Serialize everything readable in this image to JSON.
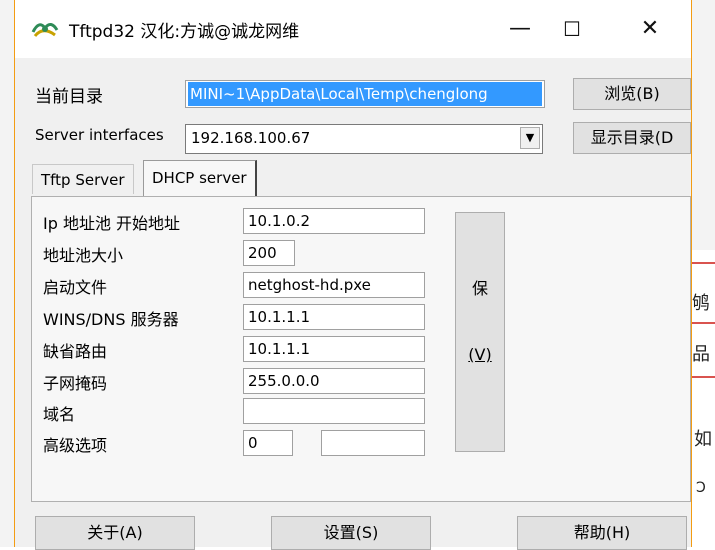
{
  "window": {
    "title": "Tftpd32 汉化:方诚@诚龙网维",
    "minimize": "—",
    "maximize": "☐",
    "close": "✕"
  },
  "top": {
    "current_dir_label": "当前目录",
    "current_dir_value": "MINI~1\\AppData\\Local\\Temp\\chenglong",
    "browse_label": "浏览(B)",
    "server_interfaces_label": "Server interfaces",
    "server_interface_value": "192.168.100.67",
    "show_dir_label": "显示目录(D"
  },
  "tabs": [
    {
      "label": "Tftp Server"
    },
    {
      "label": "DHCP server"
    }
  ],
  "dhcp": {
    "fields": [
      {
        "label": "Ip 地址池 开始地址",
        "value": "10.1.0.2"
      },
      {
        "label": "地址池大小",
        "value": "200"
      },
      {
        "label": "启动文件",
        "value": "netghost-hd.pxe"
      },
      {
        "label": "WINS/DNS 服务器",
        "value": "10.1.1.1"
      },
      {
        "label": "缺省路由",
        "value": "10.1.1.1"
      },
      {
        "label": "子网掩码",
        "value": "255.0.0.0"
      },
      {
        "label": "域名",
        "value": ""
      },
      {
        "label": "高级选项",
        "value": "0",
        "value2": ""
      }
    ],
    "save_label_top": "保",
    "save_label_bottom": "(V)"
  },
  "bottom": {
    "about_label": "关于(A)",
    "settings_label": "设置(S)",
    "help_label": "帮助(H)"
  },
  "background": {
    "chars": [
      "鸲",
      "品",
      "如",
      "Ɔ"
    ]
  },
  "colors": {
    "selection": "#3399ff",
    "window_border": "#f39c12"
  }
}
